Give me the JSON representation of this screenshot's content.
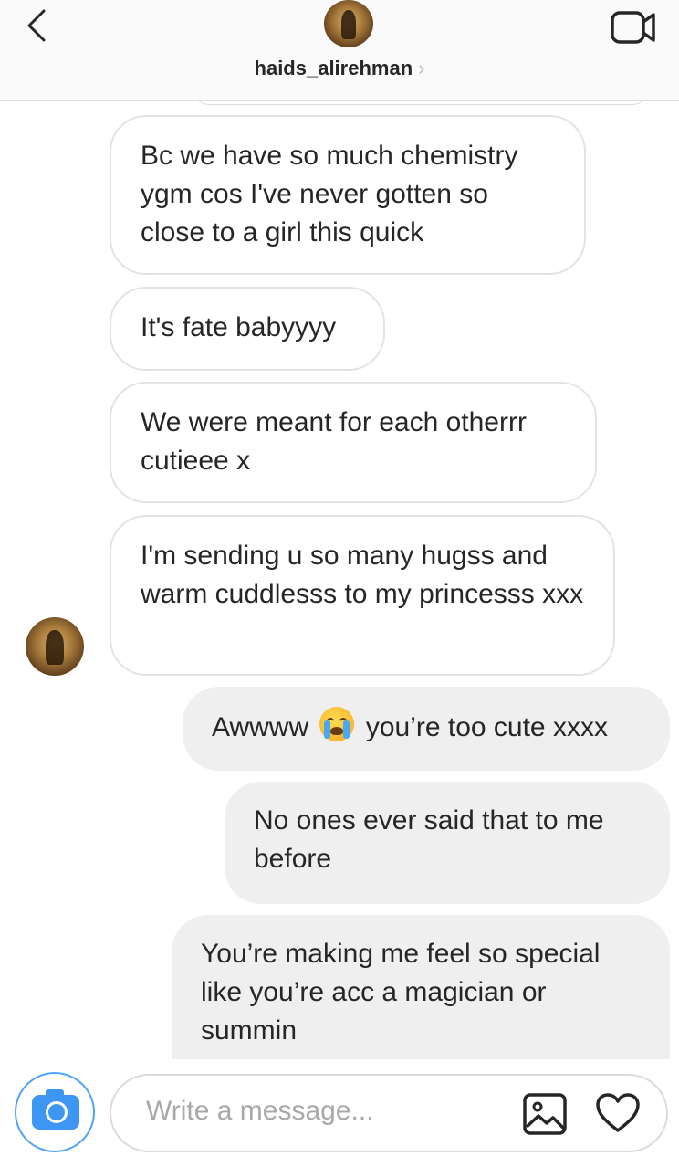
{
  "header": {
    "username": "haids_alirehman",
    "chevron": "›",
    "back_icon": "chevron-left-icon",
    "video_icon": "video-camera-icon"
  },
  "messages": [
    {
      "direction": "incoming",
      "text": "Bc we have so much chemistry ygm cos I've never gotten so close to a girl this quick"
    },
    {
      "direction": "incoming",
      "text": "It's fate babyyyy"
    },
    {
      "direction": "incoming",
      "text": "We were meant for each otherrr cutieee x"
    },
    {
      "direction": "incoming",
      "text": "I'm sending u so many hugss and warm cuddlesss to my princesss xxx"
    },
    {
      "direction": "outgoing",
      "text_before": "Awwww",
      "emoji": "crying-face-emoji",
      "text_after": "you’re too cute xxxx"
    },
    {
      "direction": "outgoing",
      "text": "No ones ever said that to me before"
    },
    {
      "direction": "outgoing",
      "text": "You’re making me feel so special like you’re acc a magician or summin"
    }
  ],
  "composer": {
    "placeholder": "Write a message...",
    "camera_icon": "camera-icon",
    "gallery_icon": "image-gallery-icon",
    "heart_icon": "heart-icon"
  },
  "colors": {
    "incoming_bubble": "#ffffff",
    "incoming_border": "#e3e3e3",
    "outgoing_bubble": "#efefef",
    "camera_accent": "#3d97f2"
  }
}
